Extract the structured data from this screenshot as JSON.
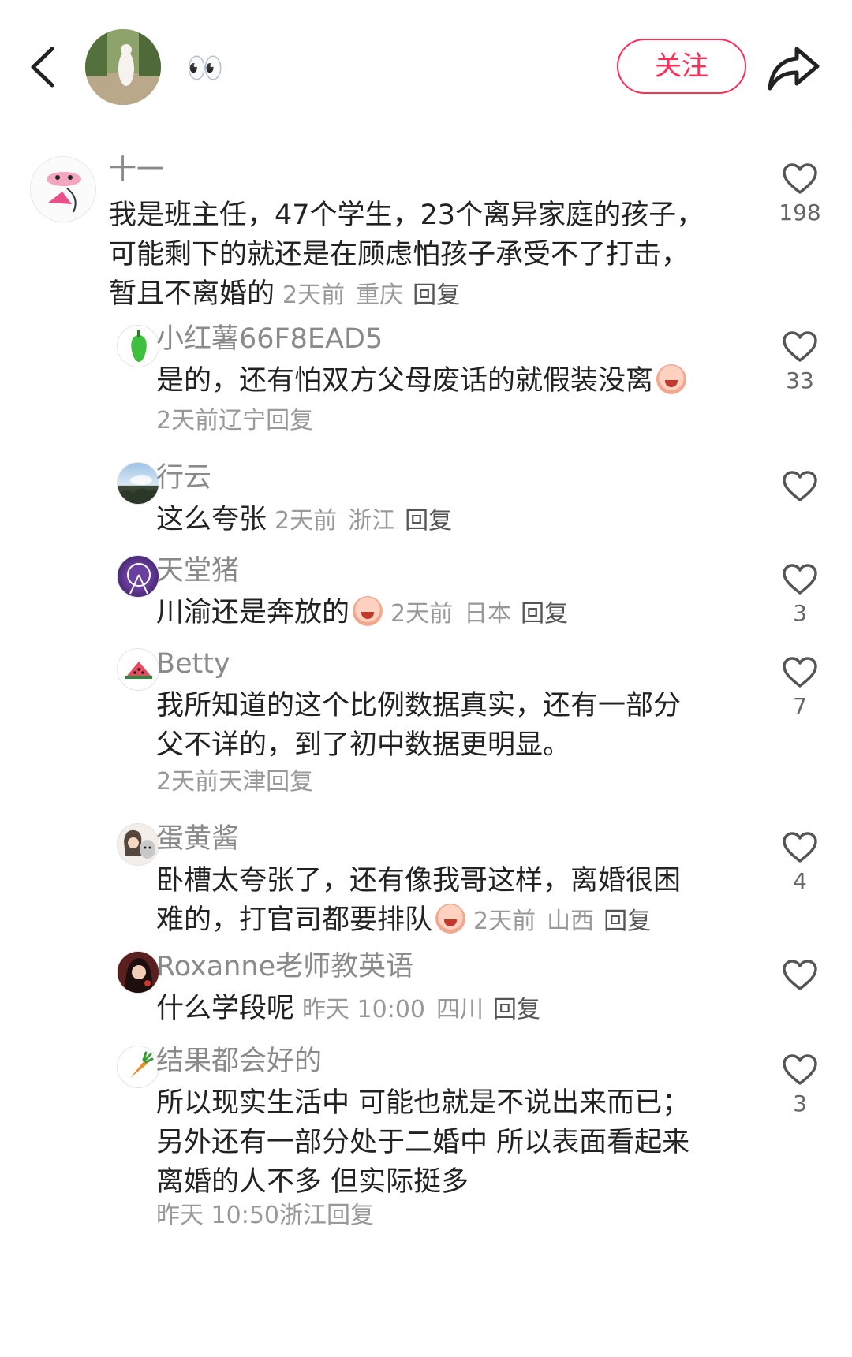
{
  "header": {
    "back_label": "back",
    "author_name": "👀",
    "follow_label": "关注",
    "share_label": "share"
  },
  "colors": {
    "accent": "#ff2d55",
    "text": "#222222",
    "muted": "#999999",
    "username": "#8a8a8a"
  },
  "comments": [
    {
      "username": "十一",
      "lines": [
        "我是班主任，47个学生，23个离异家庭的孩子，",
        "可能剩下的就还是在顾虑怕孩子承受不了打击，",
        "暂且不离婚的"
      ],
      "time": "2天前",
      "location": "重庆",
      "reply_label": "回复",
      "likes": "198",
      "avatar_icon": "cartoon-avatar-icon"
    },
    {
      "username": "小红薯66F8EAD5",
      "lines": [
        "是的，还有怕双方父母废话的就假装没离"
      ],
      "time": "2天前",
      "location": "辽宁",
      "reply_label": "回复",
      "likes": "33",
      "avatar_icon": "green-pepper-icon"
    },
    {
      "username": "行云",
      "lines": [
        "这么夸张"
      ],
      "time": "2天前",
      "location": "浙江",
      "reply_label": "回复",
      "likes": "",
      "avatar_icon": "sky-photo-avatar"
    },
    {
      "username": "天堂猪",
      "lines": [
        "川渝还是奔放的"
      ],
      "time": "2天前",
      "location": "日本",
      "reply_label": "回复",
      "likes": "3",
      "avatar_icon": "ferris-wheel-avatar"
    },
    {
      "username": "Betty",
      "lines": [
        "我所知道的这个比例数据真实，还有一部分",
        "父不详的，到了初中数据更明显。"
      ],
      "time": "2天前",
      "location": "天津",
      "reply_label": "回复",
      "likes": "7",
      "avatar_icon": "watermelon-icon"
    },
    {
      "username": "蛋黄酱",
      "lines": [
        "卧槽太夸张了，还有像我哥这样，离婚很困",
        "难的，打官司都要排队"
      ],
      "time": "2天前",
      "location": "山西",
      "reply_label": "回复",
      "likes": "4",
      "avatar_icon": "girl-with-dog-avatar"
    },
    {
      "username": "Roxanne老师教英语",
      "lines": [
        "什么学段呢"
      ],
      "time": "昨天 10:00",
      "location": "四川",
      "reply_label": "回复",
      "likes": "",
      "avatar_icon": "woman-portrait-avatar"
    },
    {
      "username": "结果都会好的",
      "lines": [
        "所以现实生活中 可能也就是不说出来而已；",
        "另外还有一部分处于二婚中 所以表面看起来",
        "离婚的人不多 但实际挺多"
      ],
      "time": "昨天 10:50",
      "location": "浙江",
      "reply_label": "回复",
      "likes": "3",
      "avatar_icon": "carrot-icon"
    }
  ]
}
